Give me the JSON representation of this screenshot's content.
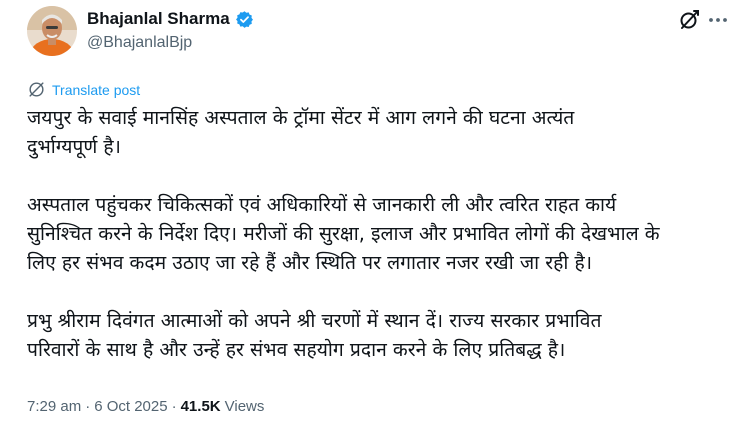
{
  "author": {
    "name": "Bhajanlal Sharma",
    "handle": "@BhajanlalBjp",
    "verified": true,
    "verified_color": "#1d9bf0",
    "avatar_icon": "profile-photo"
  },
  "actions": {
    "grok_icon": "grok-icon",
    "more_icon": "more-horizontal-icon"
  },
  "translate": {
    "label": "Translate post",
    "color": "#1d9bf0"
  },
  "post": {
    "paragraphs": [
      "जयपुर के सवाई मानसिंह अस्पताल के ट्रॉमा सेंटर में आग लगने की घटना अत्यंत\nदुर्भाग्यपूर्ण है।",
      "अस्पताल पहुंचकर चिकित्सकों एवं अधिकारियों से जानकारी ली और त्वरित राहत कार्य\nसुनिश्चित करने के निर्देश दिए। मरीजों की सुरक्षा, इलाज और प्रभावित लोगों की देखभाल के\nलिए हर संभव कदम उठाए जा रहे हैं और स्थिति पर लगातार नजर रखी जा रही है।",
      "प्रभु श्रीराम दिवंगत आत्माओं को अपने श्री चरणों में स्थान दें। राज्य सरकार प्रभावित\nपरिवारों के साथ है और उन्हें हर संभव सहयोग प्रदान करने के लिए प्रतिबद्ध है।"
    ]
  },
  "meta": {
    "time": "7:29 am",
    "separator": "·",
    "date": "6 Oct 2025",
    "views_count": "41.5K",
    "views_label": "Views"
  }
}
